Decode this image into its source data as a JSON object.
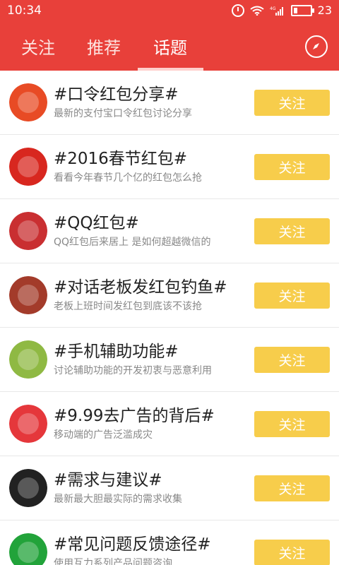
{
  "status_bar": {
    "time": "10:34",
    "network": "4G",
    "battery": "23",
    "battery_level": 0.23
  },
  "tabs": [
    {
      "label": "关注"
    },
    {
      "label": "推荐"
    },
    {
      "label": "话题"
    }
  ],
  "topics": [
    {
      "title": "#口令红包分享#",
      "desc": "最新的支付宝口令红包讨论分享",
      "button": "关注",
      "icon": "koulingicon",
      "color": "#e84b25"
    },
    {
      "title": "#2016春节红包#",
      "desc": "看看今年春节几个亿的红包怎么抢",
      "button": "关注",
      "icon": "monkey-icon",
      "color": "#d8271f"
    },
    {
      "title": "#QQ红包#",
      "desc": "QQ红包后来居上 是如何超越微信的",
      "button": "关注",
      "icon": "qq-red-packet-icon",
      "color": "#c92f31"
    },
    {
      "title": "#对话老板发红包钓鱼#",
      "desc": "老板上班时间发红包到底该不该抢",
      "button": "关注",
      "icon": "fishing-photo-icon",
      "color": "#a33b2a"
    },
    {
      "title": "#手机辅助功能#",
      "desc": "讨论辅助功能的开发初衷与恶意利用",
      "button": "关注",
      "icon": "android-icon",
      "color": "#8fb943"
    },
    {
      "title": "#9.99去广告的背后#",
      "desc": "移动端的广告泛滥成灾",
      "button": "关注",
      "icon": "grab-icon",
      "color": "#e5373b"
    },
    {
      "title": "#需求与建议#",
      "desc": "最新最大胆最实际的需求收集",
      "button": "关注",
      "icon": "person-photo-icon",
      "color": "#222222"
    },
    {
      "title": "#常见问题反馈途径#",
      "desc": "使用互力系列产品问题咨询",
      "button": "关注",
      "icon": "question-icon",
      "color": "#22a33a"
    }
  ]
}
